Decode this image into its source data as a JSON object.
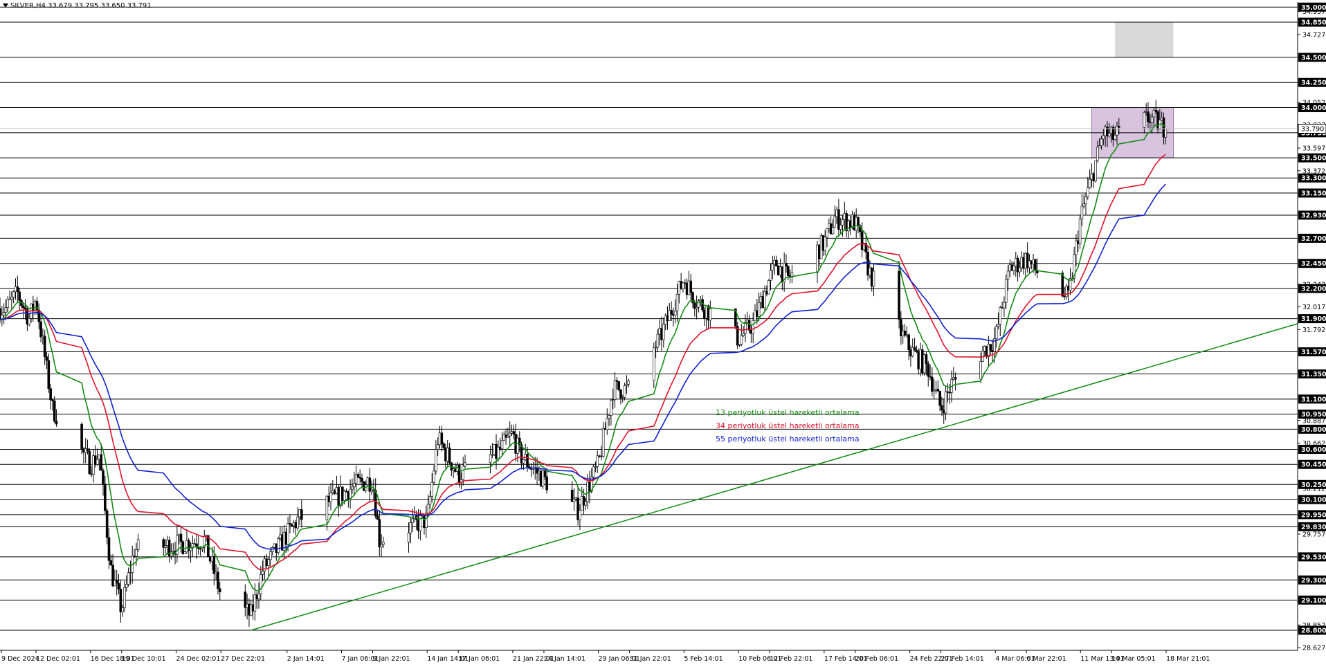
{
  "header": {
    "symbol": "SILVER,H4",
    "ohlc": "33.679 33.795 33.650 33.791"
  },
  "legend": [
    {
      "text": "13 periyotluk üstel hareketli ortalama",
      "color": "#138a13"
    },
    {
      "text": "34 periyotluk üstel hareketli ortalama",
      "color": "#e0102a"
    },
    {
      "text": "55 periyotluk üstel hareketli ortalama",
      "color": "#1020d0"
    }
  ],
  "colors": {
    "candle": "#000000",
    "level_line": "#000000",
    "ema13": "#138a13",
    "ema34": "#e0102a",
    "ema55": "#1020d0",
    "trendline": "#138a13",
    "purple_zone": "#d8c4de",
    "grey_zone": "#d9d9d9",
    "price_label_bg": "#000000",
    "price_label_fg": "#ffffff"
  },
  "chart_data": {
    "type": "candlestick",
    "symbol": "SILVER",
    "timeframe": "H4",
    "ylim": [
      28.6,
      35.05
    ],
    "horizontal_levels": [
      35.0,
      34.85,
      34.5,
      34.25,
      34.0,
      33.75,
      33.5,
      33.3,
      33.15,
      32.93,
      32.7,
      32.45,
      32.2,
      31.9,
      31.57,
      31.35,
      31.1,
      30.95,
      30.8,
      30.6,
      30.45,
      30.25,
      30.1,
      29.95,
      29.83,
      29.53,
      29.3,
      29.1,
      28.8
    ],
    "y_tick_labels": [
      "34.957",
      "34.727",
      "34.052",
      "33.827",
      "33.597",
      "33.372",
      "32.242",
      "32.017",
      "31.792",
      "30.887",
      "30.662",
      "30.212",
      "29.757",
      "29.082",
      "28.852",
      "28.627"
    ],
    "x_tick_labels": [
      "9 Dec 2024",
      "12 Dec 02:01",
      "16 Dec 18:01",
      "19 Dec 10:01",
      "24 Dec 02:01",
      "27 Dec 22:01",
      "2 Jan 14:01",
      "7 Jan 06:01",
      "9 Jan 22:01",
      "14 Jan 14:01",
      "17 Jan 06:01",
      "21 Jan 22:01",
      "24 Jan 14:01",
      "29 Jan 06:01",
      "31 Jan 22:01",
      "5 Feb 14:01",
      "10 Feb 06:01",
      "12 Feb 22:01",
      "17 Feb 14:01",
      "20 Feb 06:01",
      "24 Feb 22:01",
      "27 Feb 14:01",
      "4 Mar 06:01",
      "6 Mar 22:01",
      "11 Mar 13:01",
      "14 Mar 05:01",
      "18 Mar 21:01"
    ],
    "price_path": [
      {
        "date": "9 Dec 2024",
        "price": 32.0
      },
      {
        "date": "10 Dec 2024",
        "price": 32.15
      },
      {
        "date": "11 Dec 2024",
        "price": 31.9
      },
      {
        "date": "12 Dec 02:01",
        "price": 32.1
      },
      {
        "date": "13 Dec 2024",
        "price": 31.0
      },
      {
        "date": "16 Dec 18:01",
        "price": 30.45
      },
      {
        "date": "17 Dec 2024",
        "price": 30.55
      },
      {
        "date": "18 Dec 2024",
        "price": 29.4
      },
      {
        "date": "19 Dec 10:01",
        "price": 29.0
      },
      {
        "date": "20 Dec 2024",
        "price": 29.6
      },
      {
        "date": "24 Dec 02:01",
        "price": 29.65
      },
      {
        "date": "26 Dec 2024",
        "price": 29.7
      },
      {
        "date": "27 Dec 22:01",
        "price": 29.15
      },
      {
        "date": "30 Dec 2024",
        "price": 28.95
      },
      {
        "date": "31 Dec 2024",
        "price": 29.4
      },
      {
        "date": "2 Jan 14:01",
        "price": 29.75
      },
      {
        "date": "3 Jan 2025",
        "price": 29.9
      },
      {
        "date": "7 Jan 06:01",
        "price": 30.15
      },
      {
        "date": "8 Jan 2025",
        "price": 30.25
      },
      {
        "date": "9 Jan 22:01",
        "price": 30.3
      },
      {
        "date": "10 Jan 2025",
        "price": 29.7
      },
      {
        "date": "14 Jan 14:01",
        "price": 29.9
      },
      {
        "date": "15 Jan 2025",
        "price": 30.7
      },
      {
        "date": "17 Jan 06:01",
        "price": 30.35
      },
      {
        "date": "20 Jan 2025",
        "price": 30.55
      },
      {
        "date": "21 Jan 22:01",
        "price": 30.75
      },
      {
        "date": "22 Jan 2025",
        "price": 30.55
      },
      {
        "date": "24 Jan 14:01",
        "price": 30.3
      },
      {
        "date": "27 Jan 2025",
        "price": 30.0
      },
      {
        "date": "29 Jan 06:01",
        "price": 30.45
      },
      {
        "date": "30 Jan 2025",
        "price": 31.2
      },
      {
        "date": "31 Jan 22:01",
        "price": 31.2
      },
      {
        "date": "3 Feb 2025",
        "price": 31.7
      },
      {
        "date": "5 Feb 14:01",
        "price": 32.3
      },
      {
        "date": "6 Feb 2025",
        "price": 32.1
      },
      {
        "date": "10 Feb 06:01",
        "price": 31.7
      },
      {
        "date": "11 Feb 2025",
        "price": 31.85
      },
      {
        "date": "12 Feb 22:01",
        "price": 32.3
      },
      {
        "date": "13 Feb 2025",
        "price": 32.45
      },
      {
        "date": "14 Feb 2025",
        "price": 32.3
      },
      {
        "date": "17 Feb 14:01",
        "price": 32.65
      },
      {
        "date": "18 Feb 2025",
        "price": 32.9
      },
      {
        "date": "20 Feb 06:01",
        "price": 32.85
      },
      {
        "date": "21 Feb 2025",
        "price": 32.35
      },
      {
        "date": "24 Feb 22:01",
        "price": 31.6
      },
      {
        "date": "26 Feb 2025",
        "price": 31.4
      },
      {
        "date": "27 Feb 14:01",
        "price": 31.0
      },
      {
        "date": "28 Feb 2025",
        "price": 31.25
      },
      {
        "date": "4 Mar 06:01",
        "price": 31.7
      },
      {
        "date": "5 Mar 2025",
        "price": 32.4
      },
      {
        "date": "6 Mar 22:01",
        "price": 32.5
      },
      {
        "date": "7 Mar 2025",
        "price": 32.4
      },
      {
        "date": "10 Mar 2025",
        "price": 32.1
      },
      {
        "date": "11 Mar 13:01",
        "price": 32.9
      },
      {
        "date": "12 Mar 2025",
        "price": 33.3
      },
      {
        "date": "13 Mar 2025",
        "price": 33.75
      },
      {
        "date": "14 Mar 05:01",
        "price": 33.7
      },
      {
        "date": "17 Mar 2025",
        "price": 33.9
      },
      {
        "date": "18 Mar 21:01",
        "price": 33.79
      }
    ],
    "series": [
      {
        "name": "13 periyotluk üstel hareketli ortalama",
        "period": 13,
        "color": "#138a13"
      },
      {
        "name": "34 periyotluk üstel hareketli ortalama",
        "period": 34,
        "color": "#e0102a"
      },
      {
        "name": "55 periyotluk üstel hareketli ortalama",
        "period": 55,
        "color": "#1020d0"
      }
    ],
    "trendline": {
      "start": {
        "date": "30 Dec 2024",
        "price": 28.8
      },
      "end_value": 31.85
    },
    "zones": [
      {
        "color": "#d8c4de",
        "from_date": "12 Mar 2025",
        "to_date": "19 Mar 2025",
        "price_low": 33.5,
        "price_high": 34.0
      },
      {
        "color": "#d9d9d9",
        "from_date": "14 Mar 2025",
        "to_date": "19 Mar 2025",
        "price_low": 34.5,
        "price_high": 34.85
      }
    ],
    "last_price": 33.79,
    "grid": false
  }
}
